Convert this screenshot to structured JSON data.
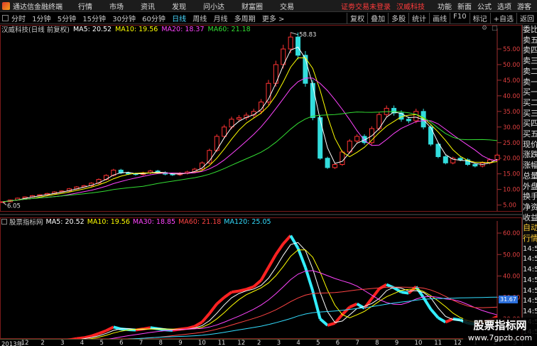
{
  "app": {
    "title": "通达信金融终端",
    "menu": [
      "行情",
      "市场",
      "资讯",
      "发现",
      "问小达",
      "财富圈",
      "交易"
    ],
    "warning": "证劵交易未登录",
    "stock_link": "汉威科技",
    "right_menu": [
      "功能",
      "新面",
      "公式",
      "选项"
    ],
    "guest": "游客"
  },
  "periods": {
    "items": [
      "分时",
      "1分钟",
      "5分钟",
      "15分钟",
      "30分钟",
      "60分钟",
      "日线",
      "周线",
      "月线",
      "多周期",
      "更多 >"
    ],
    "active": "日线"
  },
  "tools": [
    "复权",
    "叠加",
    "多股",
    "统计",
    "画线",
    "F10",
    "标记",
    "+自选",
    "返回"
  ],
  "main": {
    "name": "汉威科技(日线 前复权)",
    "ma": [
      {
        "label": "MA5: 20.52",
        "color": "#ffffff"
      },
      {
        "label": "MA10: 19.56",
        "color": "#ffff00"
      },
      {
        "label": "MA20: 18.37",
        "color": "#ff44ff"
      },
      {
        "label": "MA60: 21.18",
        "color": "#33dd33"
      }
    ],
    "y_ticks": [
      "55.00",
      "50.00",
      "45.00",
      "40.00",
      "35.00",
      "30.00",
      "25.00",
      "20.00",
      "15.00",
      "10.00",
      "5.00"
    ],
    "high_label": "58.83",
    "low_label": "6.05"
  },
  "indicator": {
    "name": "股票指标网",
    "ma": [
      {
        "label": "MA5: 20.52",
        "color": "#ffffff"
      },
      {
        "label": "MA10: 19.56",
        "color": "#ffff00"
      },
      {
        "label": "MA30: 18.85",
        "color": "#ff44ff"
      },
      {
        "label": "MA60: 21.18",
        "color": "#ff4444"
      },
      {
        "label": "MA120: 25.05",
        "color": "#33ddff"
      }
    ],
    "y_ticks": [
      "60.00",
      "50.00",
      "40.00",
      "30.00",
      "20.00"
    ],
    "last_value": "31.67"
  },
  "right_panel": {
    "items": [
      "委比",
      "卖五",
      "卖四",
      "卖三",
      "卖二",
      "卖一",
      "买一",
      "买二",
      "买三",
      "买四",
      "买五",
      "现价",
      "涨跌",
      "涨幅",
      "总量",
      "外盘",
      "换手",
      "净资",
      "收益",
      "自动",
      "行情"
    ],
    "times": [
      "14:56",
      "14:56",
      "14:56",
      "14:56",
      "14:56",
      "14:56",
      "14:56",
      "14:56",
      "14:56"
    ]
  },
  "time_axis": [
    "2013年",
    "12",
    "2",
    "3",
    "4",
    "5",
    "6",
    "7",
    "8",
    "9",
    "10",
    "11",
    "12",
    "2",
    "3",
    "4",
    "5",
    "6",
    "7",
    "8",
    "9",
    "10",
    "11",
    "12",
    "1",
    "2",
    "3"
  ],
  "watermark": {
    "line1": "股票指标网",
    "line2": "www.7gpzb.com"
  },
  "chart_data": {
    "type": "line",
    "y_range_main": [
      4,
      60
    ],
    "y_range_indicator": [
      12,
      63
    ],
    "close": [
      6.05,
      6.6,
      7.2,
      7.6,
      8.0,
      8.3,
      8.7,
      9.2,
      9.5,
      10.2,
      10.8,
      11.2,
      12.0,
      13.2,
      14.5,
      16.2,
      15.3,
      15.0,
      14.8,
      15.3,
      15.9,
      15.4,
      14.9,
      14.7,
      15.2,
      15.6,
      16.5,
      18.5,
      22.5,
      27.0,
      30.0,
      32.5,
      33.0,
      33.8,
      35.0,
      38.0,
      44.0,
      50.0,
      55.0,
      58.83,
      53.0,
      44.0,
      33.0,
      20.0,
      17.0,
      18.0,
      22.0,
      25.5,
      27.0,
      25.0,
      29.5,
      34.0,
      36.0,
      34.5,
      32.5,
      32.0,
      35.0,
      30.0,
      24.5,
      20.5,
      18.5,
      20.0,
      19.5,
      18.0,
      17.5,
      18.5,
      19.5,
      21.0
    ],
    "indicator_high": 60.5,
    "indicator_last": 31.67
  }
}
